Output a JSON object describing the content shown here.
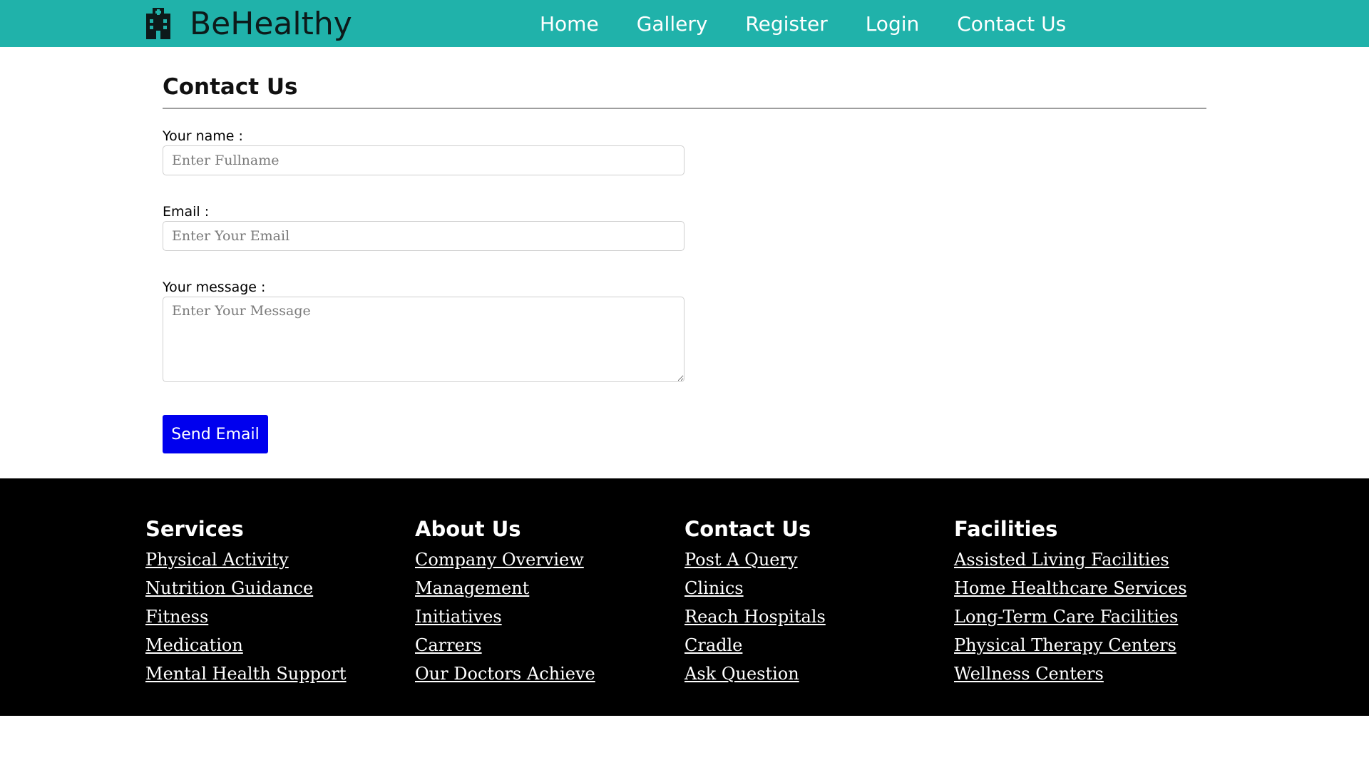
{
  "header": {
    "brand": "BeHealthy",
    "brand_icon": "hospital-building-icon",
    "nav": [
      "Home",
      "Gallery",
      "Register",
      "Login",
      "Contact Us"
    ]
  },
  "contact_form": {
    "title": "Contact Us",
    "name_label": "Your name :",
    "name_placeholder": "Enter Fullname",
    "email_label": "Email :",
    "email_placeholder": "Enter Your Email",
    "message_label": "Your message :",
    "message_placeholder": "Enter Your Message",
    "submit_label": "Send Email",
    "submit_color": "#0000ee"
  },
  "footer": {
    "columns": [
      {
        "heading": "Services",
        "links": [
          "Physical Activity",
          "Nutrition Guidance",
          "Fitness",
          "Medication",
          "Mental Health Support"
        ]
      },
      {
        "heading": "About Us",
        "links": [
          "Company Overview",
          "Management",
          "Initiatives",
          "Carrers",
          "Our Doctors Achieve"
        ]
      },
      {
        "heading": "Contact Us",
        "links": [
          "Post A Query",
          "Clinics",
          "Reach Hospitals",
          "Cradle",
          "Ask Question"
        ]
      },
      {
        "heading": "Facilities",
        "links": [
          "Assisted Living Facilities",
          "Home Healthcare Services",
          "Long-Term Care Facilities",
          "Physical Therapy Centers",
          "Wellness Centers"
        ]
      }
    ]
  },
  "colors": {
    "navbar": "#20b2aa",
    "footer": "#000000",
    "button": "#0000ee"
  }
}
